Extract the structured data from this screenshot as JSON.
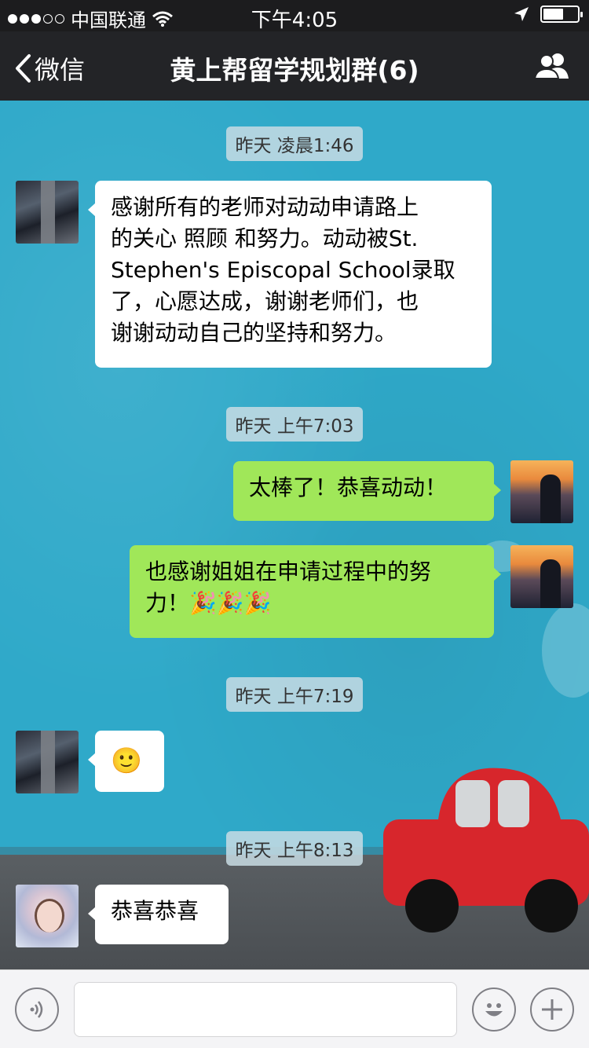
{
  "status_bar": {
    "carrier": "中国联通",
    "time": "下午4:05",
    "signal_icon": "signal-dots-icon",
    "wifi_icon": "wifi-icon",
    "location_icon": "location-arrow-icon",
    "battery_icon": "battery-icon"
  },
  "nav": {
    "back_label": "微信",
    "title": "黄上帮留学规划群(6)",
    "group_icon": "group-members-icon"
  },
  "messages": [
    {
      "type": "timestamp",
      "text": "昨天 凌晨1:46"
    },
    {
      "type": "incoming",
      "sender_avatar": "avatar-a",
      "lines": [
        "感谢所有的老师对动动申请路上",
        "的关心 照顾 和努力。动动被St.",
        "Stephen's Episcopal School录取",
        "了，心愿达成，谢谢老师们，也",
        "谢谢动动自己的坚持和努力。"
      ]
    },
    {
      "type": "timestamp",
      "text": "昨天 上午7:03"
    },
    {
      "type": "outgoing",
      "sender_avatar": "avatar-me",
      "lines": [
        "太棒了！恭喜动动！"
      ]
    },
    {
      "type": "outgoing",
      "sender_avatar": "avatar-me",
      "lines": [
        "也感谢姐姐在申请过程中的努",
        "力！"
      ],
      "emoji": "🎉🎉🎉"
    },
    {
      "type": "timestamp",
      "text": "昨天 上午7:19"
    },
    {
      "type": "incoming",
      "sender_avatar": "avatar-a",
      "emoji": "🙂"
    },
    {
      "type": "timestamp",
      "text": "昨天 上午8:13"
    },
    {
      "type": "incoming",
      "sender_avatar": "avatar-b",
      "lines": [
        "恭喜恭喜"
      ]
    }
  ],
  "input_bar": {
    "voice_icon": "voice-icon",
    "emoji_icon": "emoji-face-icon",
    "add_icon": "plus-icon",
    "placeholder": ""
  },
  "colors": {
    "nav_bg": "#232427",
    "chat_bg": "#2fa9c9",
    "bubble_out": "#a0e759",
    "bubble_in": "#ffffff"
  }
}
